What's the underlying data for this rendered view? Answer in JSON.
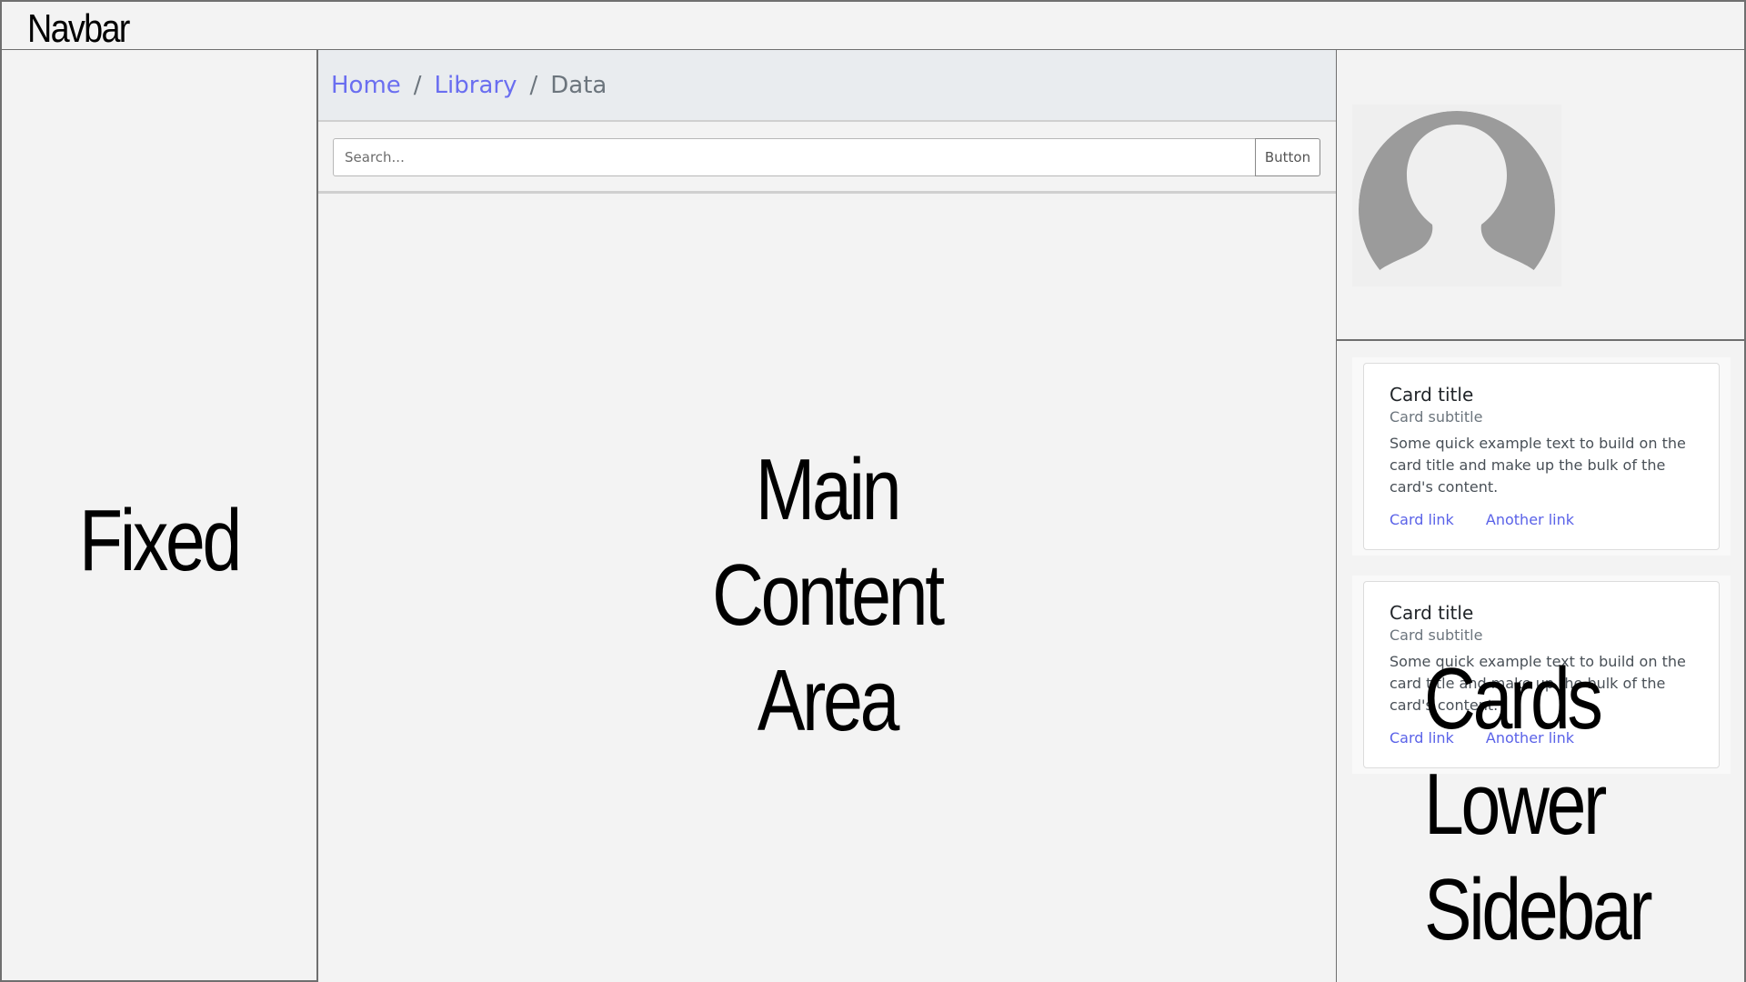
{
  "navbar": {
    "title": "Navbar"
  },
  "fixed_sidebar": {
    "label": "Fixed"
  },
  "breadcrumb": {
    "items": [
      {
        "label": "Home"
      },
      {
        "label": "Library"
      },
      {
        "label": "Data"
      }
    ],
    "separator": "/"
  },
  "search": {
    "placeholder": "Search...",
    "button_label": "Button"
  },
  "main": {
    "label_lines": [
      "Main",
      "Content",
      "Area"
    ]
  },
  "right_sidebar": {
    "avatar": {
      "icon": "user-avatar-icon"
    },
    "cards": [
      {
        "title": "Card title",
        "subtitle": "Card subtitle",
        "text": "Some quick example text to build on the card title and make up the bulk of the card's content.",
        "links": [
          "Card link",
          "Another link"
        ]
      },
      {
        "title": "Card title",
        "subtitle": "Card subtitle",
        "text": "Some quick example text to build on the card title and make up the bulk of the card's content.",
        "links": [
          "Card link",
          "Another link"
        ]
      }
    ],
    "label_lines": [
      "Cards",
      "Lower",
      "Sidebar"
    ]
  },
  "colors": {
    "link": "#6a6ef0",
    "border": "#6f6f6f",
    "background": "#f3f3f3",
    "breadcrumb_bg": "#e9ecef",
    "avatar": "#9b9b9b"
  }
}
